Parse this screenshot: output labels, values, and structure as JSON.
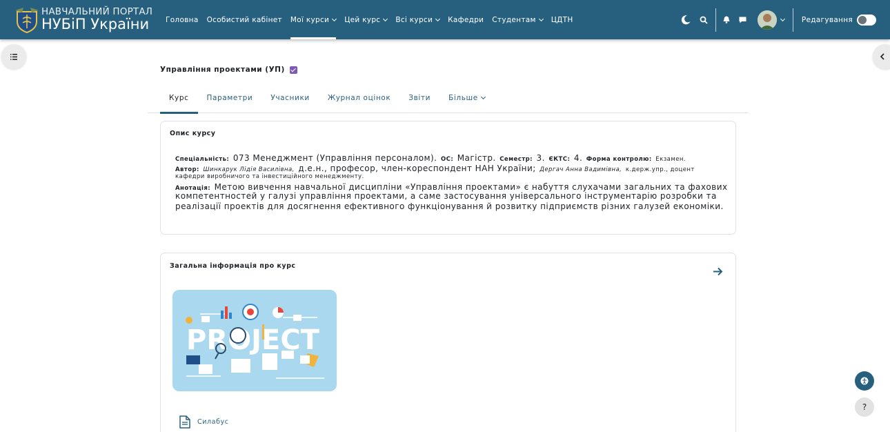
{
  "header": {
    "logo_line1": "НАВЧАЛЬНИЙ ПОРТАЛ",
    "logo_line2": "НУБіП України",
    "nav_items": [
      {
        "label": "Головна"
      },
      {
        "label": "Особистий кабінет"
      },
      {
        "label": "Мої курси"
      },
      {
        "label": "Цей курс"
      },
      {
        "label": "Всі курси"
      },
      {
        "label": "Кафедри"
      },
      {
        "label": "Студентам"
      },
      {
        "label": "ЦДТН"
      }
    ],
    "edit_mode_label": "Редагування",
    "colors": {
      "navbar": "#27607f",
      "accent": "#27607f"
    }
  },
  "course": {
    "title": "Управління проектами (УП)",
    "tabs": [
      {
        "label": "Курс"
      },
      {
        "label": "Параметри"
      },
      {
        "label": "Учасники"
      },
      {
        "label": "Журнал оцінок"
      },
      {
        "label": "Звіти"
      },
      {
        "label": "Більше"
      }
    ]
  },
  "description_card": {
    "title": "Опис курсу",
    "spec_label": "Спеціальність:",
    "spec_value": "073 Менеджмент (Управління персоналом).",
    "os_label": "ОС:",
    "os_value": "Магістр.",
    "semester_label": "Семестр:",
    "semester_value": "3.",
    "ects_label": "ЄКТС:",
    "ects_value": "4.",
    "control_label": "Форма контролю:",
    "control_value": "Екзамен.",
    "author_label": "Автор:",
    "author1": "Шинкарук Лідія Василівна,",
    "author1_title": "д.е.н., професор, член-кореспондент НАН України;",
    "author2": "Дергач Анна Вадимівна,",
    "author2_title": "к.держ.упр., доцент",
    "author2_dept": "кафедри виробничого та інвестиційного менеджменту.",
    "annotation_label": "Анотація:",
    "annotation_line1": "Метою вивчення навчальної дисципліни «Управління проектами» є набуття слухачами загальних та фахових",
    "annotation_line2": "компетентностей у галузі управління проектами, а саме застосування універсального інструментарію розробки та",
    "annotation_line3": "реалізації проектів для досягнення ефективного функціонування й розвитку підприємств різних галузей економіки."
  },
  "general_card": {
    "title": "Загальна інформація про курс",
    "image_text": "PROJECT",
    "syllabus_label": "Силабус"
  },
  "floating": {
    "accessibility_icon": "accessibility-icon",
    "help_label": "?"
  }
}
